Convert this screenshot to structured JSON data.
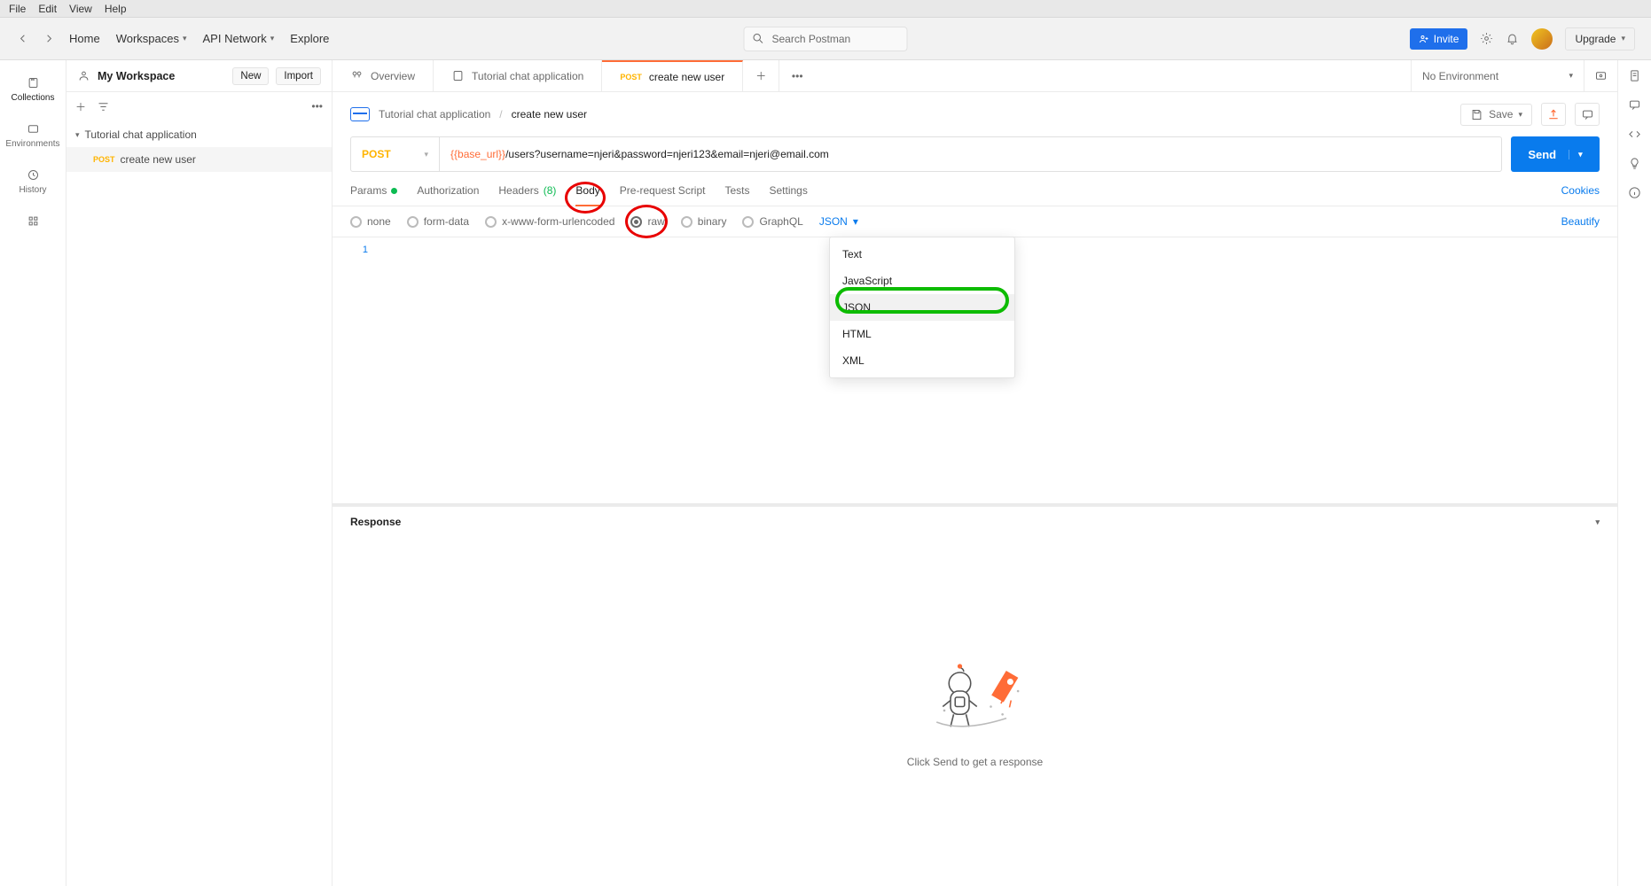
{
  "menubar": {
    "file": "File",
    "edit": "Edit",
    "view": "View",
    "help": "Help"
  },
  "topbar": {
    "home": "Home",
    "workspaces": "Workspaces",
    "api_network": "API Network",
    "explore": "Explore",
    "search_placeholder": "Search Postman",
    "invite": "Invite",
    "upgrade": "Upgrade"
  },
  "left_rail": {
    "collections": "Collections",
    "environments": "Environments",
    "history": "History"
  },
  "workspace": {
    "title": "My Workspace",
    "new": "New",
    "import": "Import"
  },
  "tree": {
    "collection": "Tutorial chat application",
    "request_method": "POST",
    "request_name": "create new user"
  },
  "tabs": {
    "overview": "Overview",
    "collection_name": "Tutorial chat application",
    "active_method": "POST",
    "active_name": "create new user",
    "environment": "No Environment"
  },
  "breadcrumb": {
    "collection": "Tutorial chat application",
    "request": "create new user",
    "save": "Save"
  },
  "request": {
    "method": "POST",
    "url_var": "{{base_url}}",
    "url_rest": "/users?username=njeri&password=njeri123&email=njeri@email.com",
    "send": "Send"
  },
  "reqtabs": {
    "params": "Params",
    "authorization": "Authorization",
    "headers": "Headers",
    "headers_count": "(8)",
    "body": "Body",
    "prerequest": "Pre-request Script",
    "tests": "Tests",
    "settings": "Settings",
    "cookies": "Cookies"
  },
  "bodytypes": {
    "none": "none",
    "formdata": "form-data",
    "urlencoded": "x-www-form-urlencoded",
    "raw": "raw",
    "binary": "binary",
    "graphql": "GraphQL",
    "selected_lang": "JSON",
    "beautify": "Beautify"
  },
  "editor": {
    "line1": "1"
  },
  "lang_dropdown": {
    "text": "Text",
    "javascript": "JavaScript",
    "json": "JSON",
    "html": "HTML",
    "xml": "XML"
  },
  "response": {
    "header": "Response",
    "placeholder": "Click Send to get a response"
  }
}
